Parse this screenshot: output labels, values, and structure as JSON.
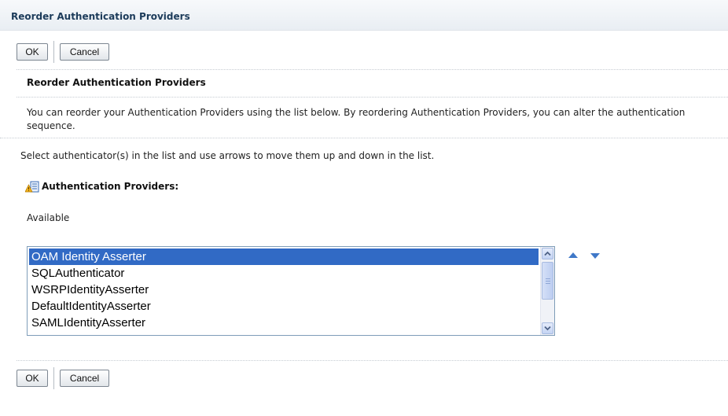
{
  "header": {
    "title": "Reorder Authentication Providers"
  },
  "buttons": {
    "ok_label": "OK",
    "cancel_label": "Cancel"
  },
  "section": {
    "title": "Reorder Authentication Providers",
    "description_line1": "You can reorder your Authentication Providers using the list below. By reordering Authentication Providers, you can alter the authentication",
    "description_line2": "sequence.",
    "instruction": "Select authenticator(s) in the list and use arrows to move them up and down in the list."
  },
  "providers": {
    "label": "Authentication Providers:",
    "available_label": "Available",
    "items": [
      "OAM Identity Asserter",
      "SQLAuthenticator",
      "WSRPIdentityAsserter",
      "DefaultIdentityAsserter",
      "SAMLIdentityAsserter"
    ],
    "selected_index": 0
  },
  "icons": {
    "providers": "warning-list-icon",
    "move_up": "triangle-up-icon",
    "move_down": "triangle-down-icon",
    "scroll_up": "chevron-up-icon",
    "scroll_down": "chevron-down-icon"
  },
  "colors": {
    "selection": "#316ac5",
    "arrow": "#3f78c8",
    "title_text": "#1c3b5a"
  }
}
